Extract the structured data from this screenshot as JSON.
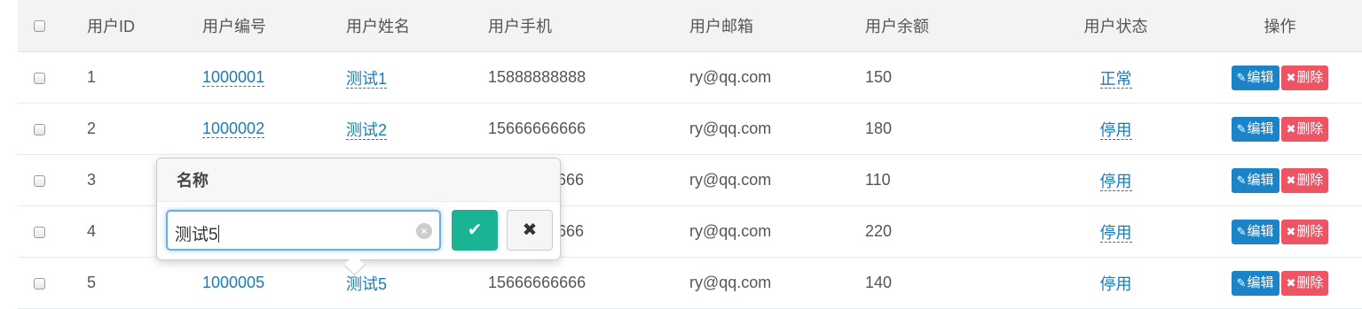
{
  "columns": {
    "id": "用户ID",
    "number": "用户编号",
    "name": "用户姓名",
    "phone": "用户手机",
    "email": "用户邮箱",
    "balance": "用户余额",
    "status": "用户状态",
    "ops": "操作"
  },
  "rows": [
    {
      "id": "1",
      "number": "1000001",
      "name": "测试1",
      "phone": "15888888888",
      "email": "ry@qq.com",
      "balance": "150",
      "status": "正常"
    },
    {
      "id": "2",
      "number": "1000002",
      "name": "测试2",
      "phone": "15666666666",
      "email": "ry@qq.com",
      "balance": "180",
      "status": "停用"
    },
    {
      "id": "3",
      "number": "",
      "name": "",
      "phone": "666",
      "email": "ry@qq.com",
      "balance": "110",
      "status": "停用"
    },
    {
      "id": "4",
      "number": "",
      "name": "",
      "phone": "666",
      "email": "ry@qq.com",
      "balance": "220",
      "status": "停用"
    },
    {
      "id": "5",
      "number": "1000005",
      "name": "测试5",
      "phone": "15666666666",
      "email": "ry@qq.com",
      "balance": "140",
      "status": "停用"
    }
  ],
  "actions": {
    "edit_label": "编辑",
    "delete_label": "删除"
  },
  "popover": {
    "title": "名称",
    "input_value": "测试5",
    "ok_glyph": "✔",
    "cancel_glyph": "✖",
    "clear_glyph": "×"
  },
  "icons": {
    "edit": "✎",
    "delete": "✖"
  },
  "colors": {
    "link": "#1a7bb9",
    "edit_button": "#1c84c6",
    "delete_button": "#ed5565",
    "ok_button": "#1ab394"
  }
}
